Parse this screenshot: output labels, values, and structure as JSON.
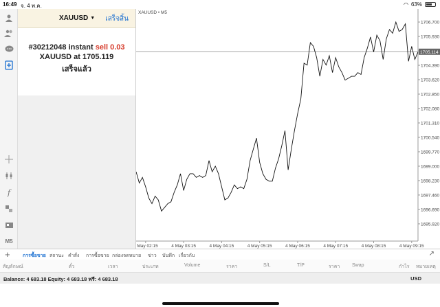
{
  "status_bar": {
    "time": "16:49",
    "date": "จ. 4 พ.ค.",
    "battery": "63%"
  },
  "panel": {
    "symbol": "XAUUSD",
    "symbol_arrow": "▼",
    "done_label": "เสร็จสิ้น",
    "result": {
      "order_prefix": "#30212048 instant",
      "order_action": "sell 0.03",
      "price_prefix": "XAUUSD at",
      "price": "1705.119",
      "status": "เสร็จแล้ว"
    }
  },
  "chart_data": {
    "type": "line",
    "title": "XAUUSD • M5",
    "current_price": "1705.114",
    "ylim": [
      1695.0,
      1707.4
    ],
    "y_ticks": [
      "1706.700",
      "1705.930",
      "1705.160",
      "1704.390",
      "1703.620",
      "1702.850",
      "1702.080",
      "1701.310",
      "1700.540",
      "1699.770",
      "1699.000",
      "1698.230",
      "1697.460",
      "1696.690",
      "1695.920"
    ],
    "x_ticks": [
      "4 May 02:15",
      "4 May 03:15",
      "4 May 04:15",
      "4 May 05:15",
      "4 May 06:15",
      "4 May 07:15",
      "4 May 08:15",
      "4 May 09:15"
    ],
    "x_tick_index": [
      3,
      15,
      27,
      39,
      51,
      63,
      75,
      87
    ],
    "values": [
      1698.7,
      1698.1,
      1698.4,
      1697.9,
      1697.3,
      1697.0,
      1697.4,
      1697.2,
      1696.6,
      1696.8,
      1697.0,
      1697.1,
      1697.6,
      1698.0,
      1698.6,
      1697.7,
      1698.3,
      1698.6,
      1698.6,
      1698.4,
      1698.5,
      1698.4,
      1698.5,
      1699.3,
      1698.7,
      1699.0,
      1698.6,
      1697.9,
      1697.2,
      1697.3,
      1697.6,
      1698.0,
      1697.8,
      1697.9,
      1697.8,
      1698.3,
      1699.3,
      1699.9,
      1700.5,
      1699.2,
      1698.6,
      1698.3,
      1698.2,
      1698.2,
      1698.9,
      1699.4,
      1700.1,
      1700.9,
      1698.8,
      1699.9,
      1700.9,
      1701.8,
      1702.6,
      1704.5,
      1704.4,
      1705.6,
      1705.4,
      1704.8,
      1703.8,
      1704.7,
      1704.4,
      1704.9,
      1704.0,
      1704.8,
      1704.3,
      1704.0,
      1703.6,
      1703.7,
      1703.8,
      1703.8,
      1704.0,
      1703.9,
      1704.8,
      1705.3,
      1705.9,
      1705.1,
      1706.0,
      1705.7,
      1704.7,
      1705.8,
      1706.3,
      1706.1,
      1706.7,
      1706.2,
      1706.3,
      1706.6,
      1704.6,
      1705.4,
      1704.7,
      1705.1
    ]
  },
  "tabs": {
    "items": [
      "การซื้อขาย",
      "สถานะ",
      "คำสั่ง",
      "การซื้อขาย",
      "กล่องจดหมาย",
      "ข่าว",
      "บันทึก",
      "เกี่ยวกับ"
    ]
  },
  "columns": {
    "items": [
      "สัญลักษณ์",
      "ตั๋ว",
      "เวลา",
      "ประเภท",
      "Volume",
      "ราคา",
      "S/L",
      "T/P",
      "ราคา",
      "Swap",
      "กำไร",
      "หมายเหตุ"
    ]
  },
  "balance": {
    "text": "Balance: 4 683.18 Equity: 4 683.18 ฟรี: 4 683.18",
    "currency": "USD"
  },
  "icons": {
    "toolbar": [
      "user-icon",
      "users-icon",
      "chat-icon",
      "new-order-icon",
      "crosshair-icon",
      "candles-icon",
      "indicator-icon",
      "objects-icon",
      "templates-icon",
      "timeframe-icon"
    ]
  },
  "timeframe_label": "M5",
  "colors": {
    "accent": "#1a6fd1",
    "sell": "#d63a2a",
    "panel_head": "#f9f3e2"
  }
}
